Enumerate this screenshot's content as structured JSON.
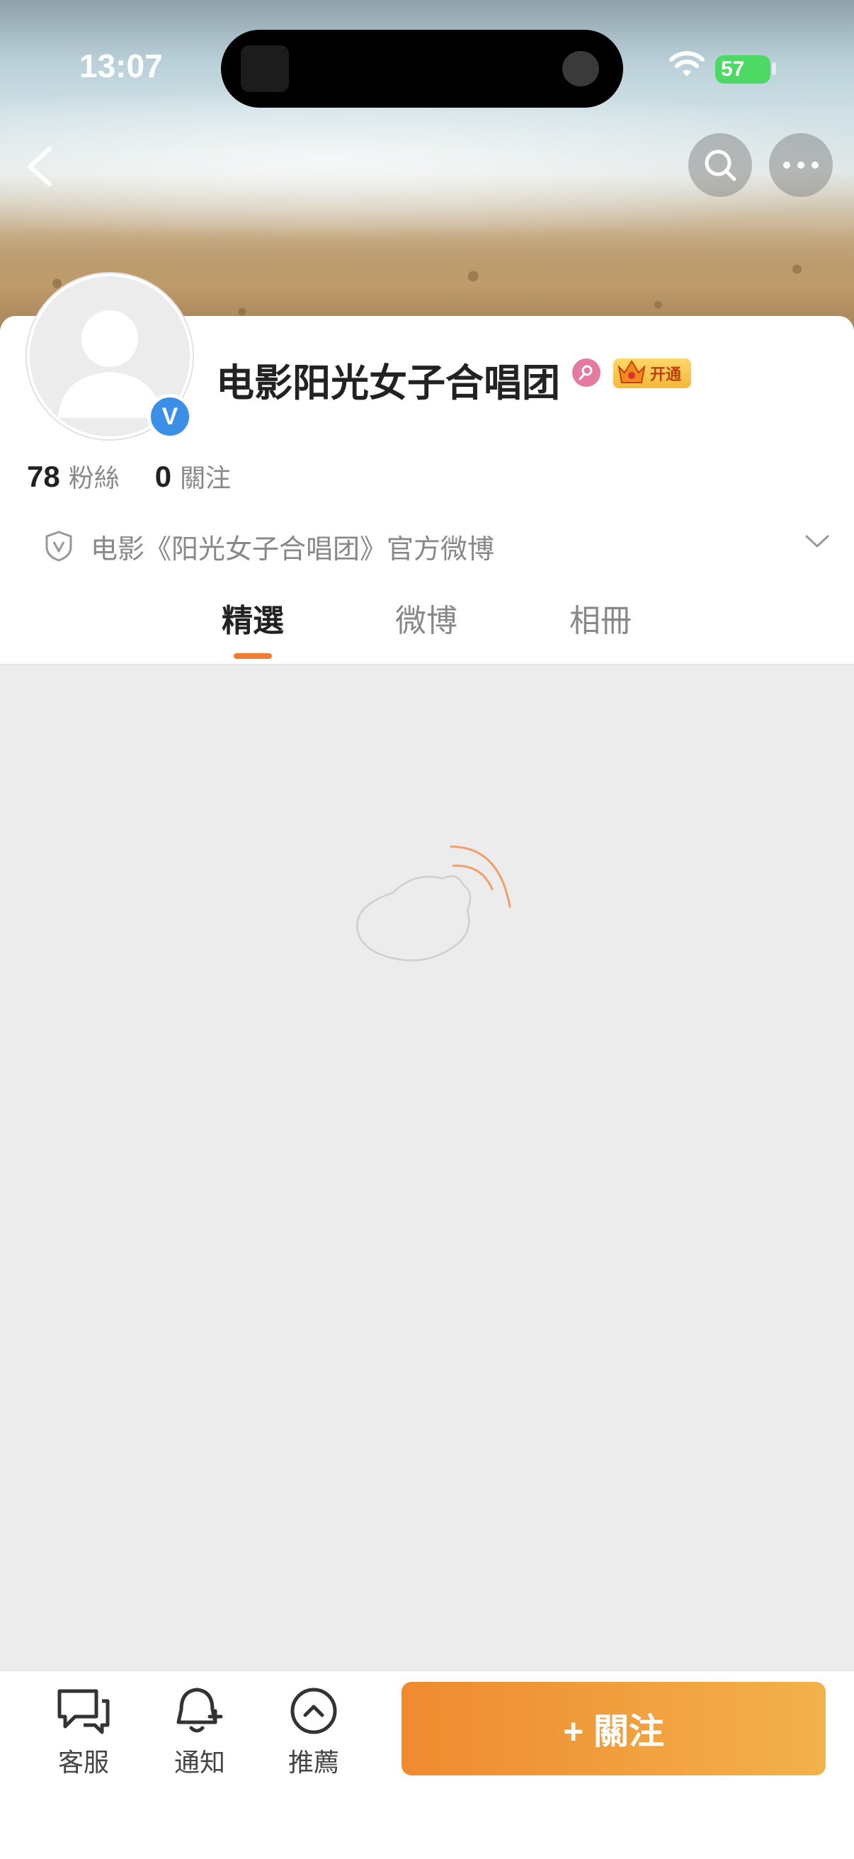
{
  "status_bar": {
    "time": "13:07",
    "battery": "57"
  },
  "profile": {
    "name": "电影阳光女子合唱团",
    "vip_label": "开通",
    "verified_mark": "V",
    "followers_count": "78",
    "followers_label": "粉絲",
    "following_count": "0",
    "following_label": "關注",
    "bio": "电影《阳光女子合唱团》官方微博"
  },
  "tabs": [
    {
      "label": "精選",
      "active": true
    },
    {
      "label": "微博",
      "active": false
    },
    {
      "label": "相冊",
      "active": false
    }
  ],
  "bottom_bar": {
    "items": [
      {
        "label": "客服",
        "icon": "chat-icon"
      },
      {
        "label": "通知",
        "icon": "bell-plus-icon"
      },
      {
        "label": "推薦",
        "icon": "chevron-up-circle-icon"
      }
    ],
    "follow_button": "+ 關注"
  },
  "colors": {
    "accent": "#f07b31",
    "verified": "#3b8fe6",
    "content_bg": "#ececec"
  }
}
